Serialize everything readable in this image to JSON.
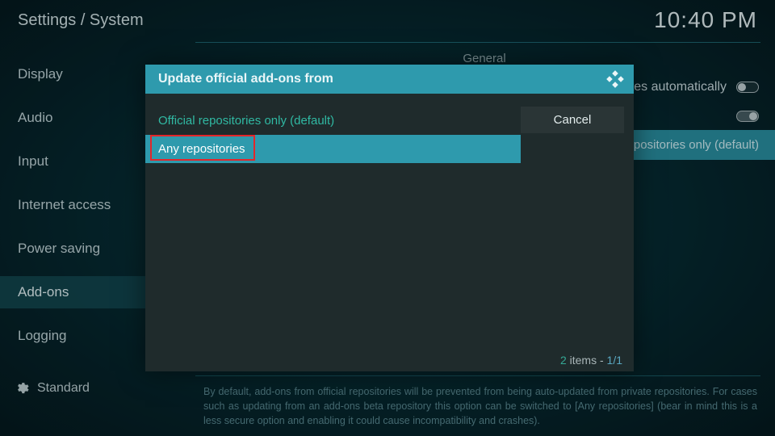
{
  "header": {
    "breadcrumb": "Settings / System",
    "clock": "10:40 PM"
  },
  "sidebar": {
    "items": [
      {
        "label": "Display"
      },
      {
        "label": "Audio"
      },
      {
        "label": "Input"
      },
      {
        "label": "Internet access"
      },
      {
        "label": "Power saving"
      },
      {
        "label": "Add-ons",
        "active": true
      },
      {
        "label": "Logging"
      }
    ]
  },
  "content": {
    "section": "General",
    "rows": [
      {
        "label_suffix": "l updates automatically",
        "toggle": "off"
      },
      {
        "label": "",
        "toggle": "on"
      },
      {
        "label": "",
        "value": "positories only (default)",
        "highlight": true
      }
    ]
  },
  "footer": {
    "level": "Standard",
    "help": "By default, add-ons from official repositories will be prevented from being auto-updated from private repositories. For cases such as updating from an add-ons beta repository this option can be switched to [Any repositories] (bear in mind this is a less secure option and enabling it could cause incompatibility and crashes)."
  },
  "dialog": {
    "title": "Update official add-ons from",
    "options": [
      {
        "label": "Official repositories only (default)",
        "default": true
      },
      {
        "label": "Any repositories",
        "selected": true,
        "highlighted": true
      }
    ],
    "cancel": "Cancel",
    "count": "2",
    "count_label": "items -",
    "page": "1/1"
  }
}
